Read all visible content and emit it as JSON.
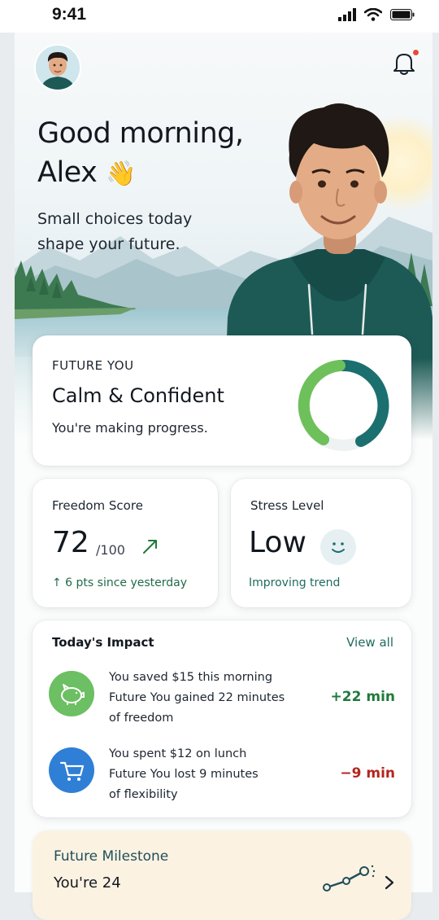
{
  "status_bar": {
    "time": "9:41",
    "icons": [
      "signal-icon",
      "wifi-icon",
      "battery-icon"
    ]
  },
  "header": {
    "greeting_line1": "Good morning,",
    "greeting_name": "Alex",
    "greeting_emoji": "👋",
    "subtitle": "Small choices today shape your future.",
    "icons": [
      "avatar",
      "bell-icon"
    ]
  },
  "future_you": {
    "label": "FUTURE YOU",
    "title": "Calm & Confident",
    "subtitle": "You're making progress.",
    "ring_colors": {
      "start": "#6dc05a",
      "end": "#1b6f6f"
    }
  },
  "freedom_score": {
    "label": "Freedom Score",
    "value": "72",
    "max": "/100",
    "delta": "↑ 6 pts since yesterday",
    "progress": 0.72
  },
  "stress_level": {
    "label": "Stress Level",
    "value": "Low",
    "trend": "Improving trend"
  },
  "todays_impact": {
    "title": "Today's Impact",
    "view_all": "View all",
    "items": [
      {
        "icon": "piggy-bank-icon",
        "line1": "You saved $15 this morning",
        "line2": "Future You gained 22 minutes",
        "line3": "of freedom",
        "delta": "+22 min",
        "color": "#1f7a3a"
      },
      {
        "icon": "shopping-cart-icon",
        "line1": "You spent $12 on lunch",
        "line2": "Future You lost 9 minutes",
        "line3": "of flexibility",
        "delta": "−9 min",
        "color": "#b3261e"
      }
    ]
  },
  "milestone": {
    "label": "Future Milestone",
    "value": "You're 24"
  },
  "colors": {
    "accent_green": "#1f6b4a",
    "accent_teal": "#1b6f6f",
    "negative_red": "#b3261e",
    "milestone_bg": "#fcf2e2"
  }
}
